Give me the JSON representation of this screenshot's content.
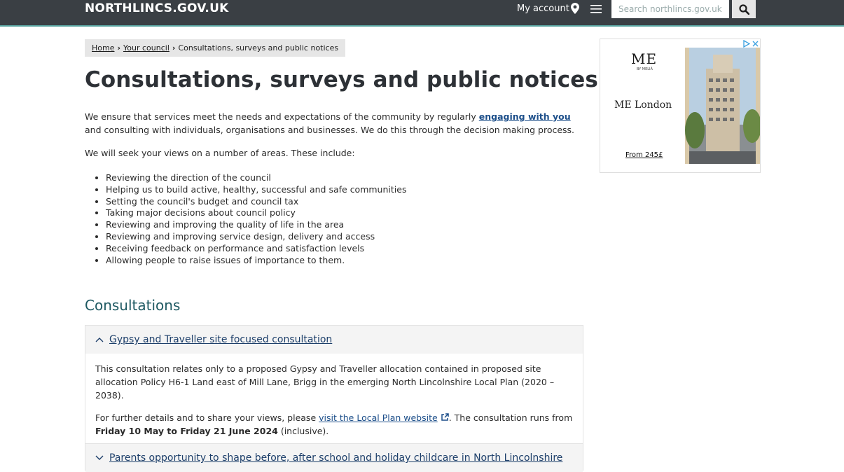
{
  "header": {
    "logo": "NORTHLINCS.GOV.UK",
    "my_account": "My account",
    "search_placeholder": "Search northlincs.gov.uk"
  },
  "breadcrumb": {
    "home": "Home",
    "your_council": "Your council",
    "current": "Consultations, surveys and public notices"
  },
  "page": {
    "title": "Consultations, surveys and public notices",
    "intro_before": "We ensure that services meet the needs and expectations of the community by regularly ",
    "intro_link": "engaging with you",
    "intro_after": " and consulting with individuals, organisations and businesses. We do this through the decision making process.",
    "areas_intro": "We will seek your views on a number of areas. These include:",
    "areas": [
      "Reviewing the direction of the council",
      "Helping us to build active, healthy, successful and safe communities",
      "Setting the council's budget and council tax",
      "Taking major decisions about council policy",
      "Reviewing and improving the quality of life in the area",
      "Reviewing and improving service design, delivery and access",
      "Receiving feedback on performance and satisfaction levels",
      "Allowing people to raise issues of importance to them."
    ]
  },
  "consultations": {
    "heading": "Consultations",
    "items": [
      {
        "title": "Gypsy and Traveller site focused consultation",
        "para1": "This consultation relates only to a proposed Gypsy and Traveller allocation contained in proposed site allocation Policy H6-1 Land east of Mill Lane, Brigg in the emerging North Lincolnshire Local Plan (2020 – 2038).",
        "para2_before": "For further details and to share your views, please ",
        "para2_link": "visit the Local Plan website",
        "para2_mid": ". The consultation runs from ",
        "para2_dates": "Friday 10 May to Friday 21 June 2024",
        "para2_after": " (inclusive)."
      },
      {
        "title": "Parents opportunity to shape before, after school and holiday childcare in North Lincolnshire"
      }
    ]
  },
  "ad": {
    "brand": "ME",
    "brand_sub": "BY MELIÁ",
    "hotel_name": "ME London",
    "price": "From 245£"
  }
}
